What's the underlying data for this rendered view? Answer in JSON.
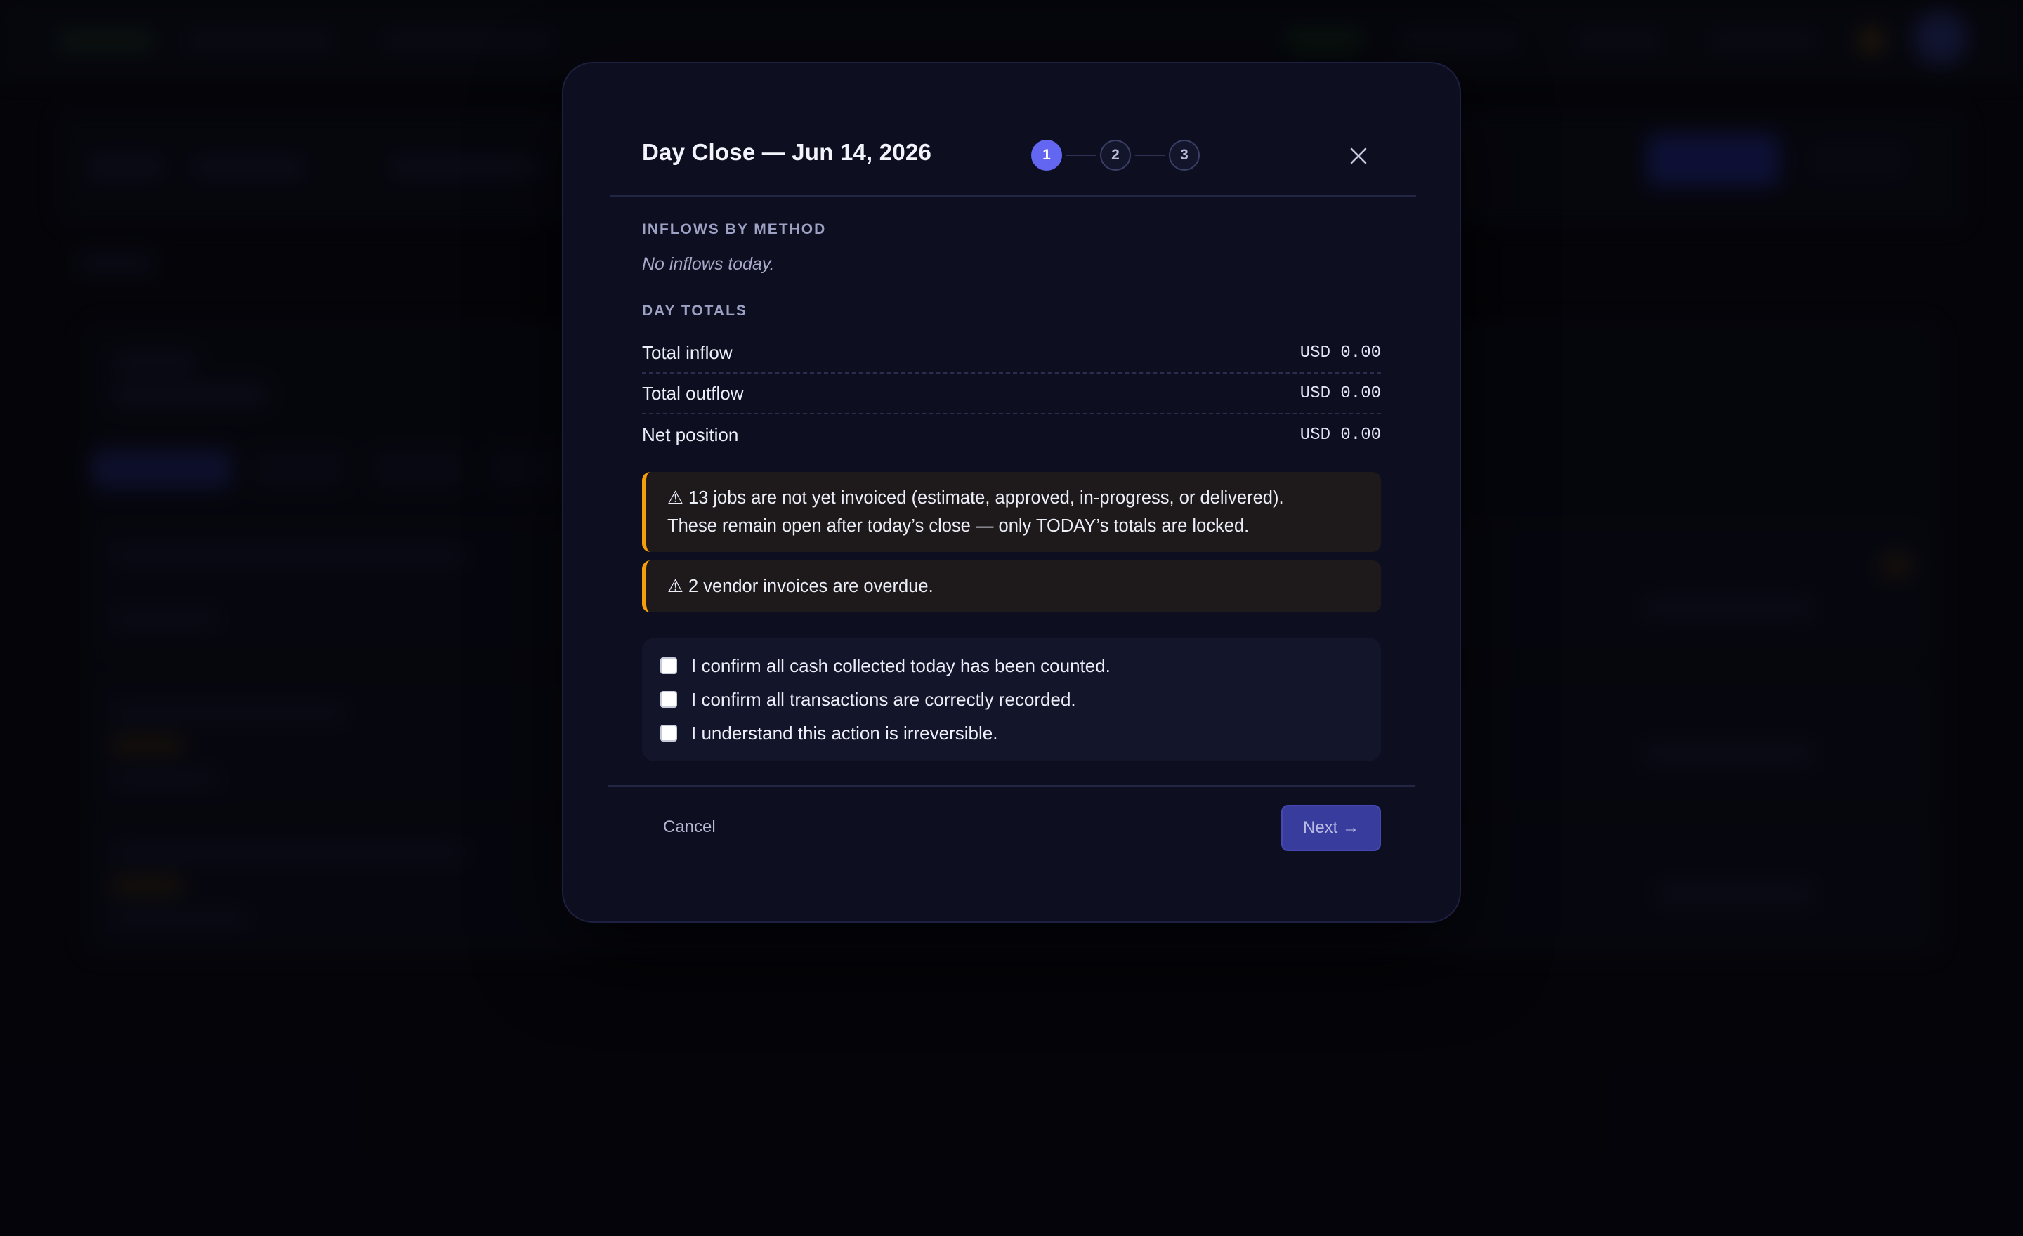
{
  "modal": {
    "title": "Day Close — Jun 14, 2026",
    "steps": [
      "1",
      "2",
      "3"
    ],
    "active_step": 1,
    "close_icon": "close-icon"
  },
  "inflows": {
    "heading": "INFLOWS BY METHOD",
    "empty_text": "No inflows today."
  },
  "totals": {
    "heading": "DAY TOTALS",
    "rows": [
      {
        "label": "Total inflow",
        "value": "USD 0.00"
      },
      {
        "label": "Total outflow",
        "value": "USD 0.00"
      },
      {
        "label": "Net position",
        "value": "USD 0.00"
      }
    ]
  },
  "alerts": {
    "jobs_line1": "⚠ 13 jobs are not yet invoiced (estimate, approved, in-progress, or delivered).",
    "jobs_line2": "These remain open after today’s close — only TODAY’s totals are locked.",
    "vendors": "⚠ 2 vendor invoices are overdue.",
    "accent_color": "#f59e0b"
  },
  "confirmations": [
    {
      "label": "I confirm all cash collected today has been counted.",
      "checked": false
    },
    {
      "label": "I confirm all transactions are correctly recorded.",
      "checked": false
    },
    {
      "label": "I understand this action is irreversible.",
      "checked": false
    }
  ],
  "footer": {
    "cancel_label": "Cancel",
    "next_label": "Next →"
  },
  "colors": {
    "primary": "#6366f1",
    "background": "#06060c",
    "modal": "#0d0e20"
  }
}
